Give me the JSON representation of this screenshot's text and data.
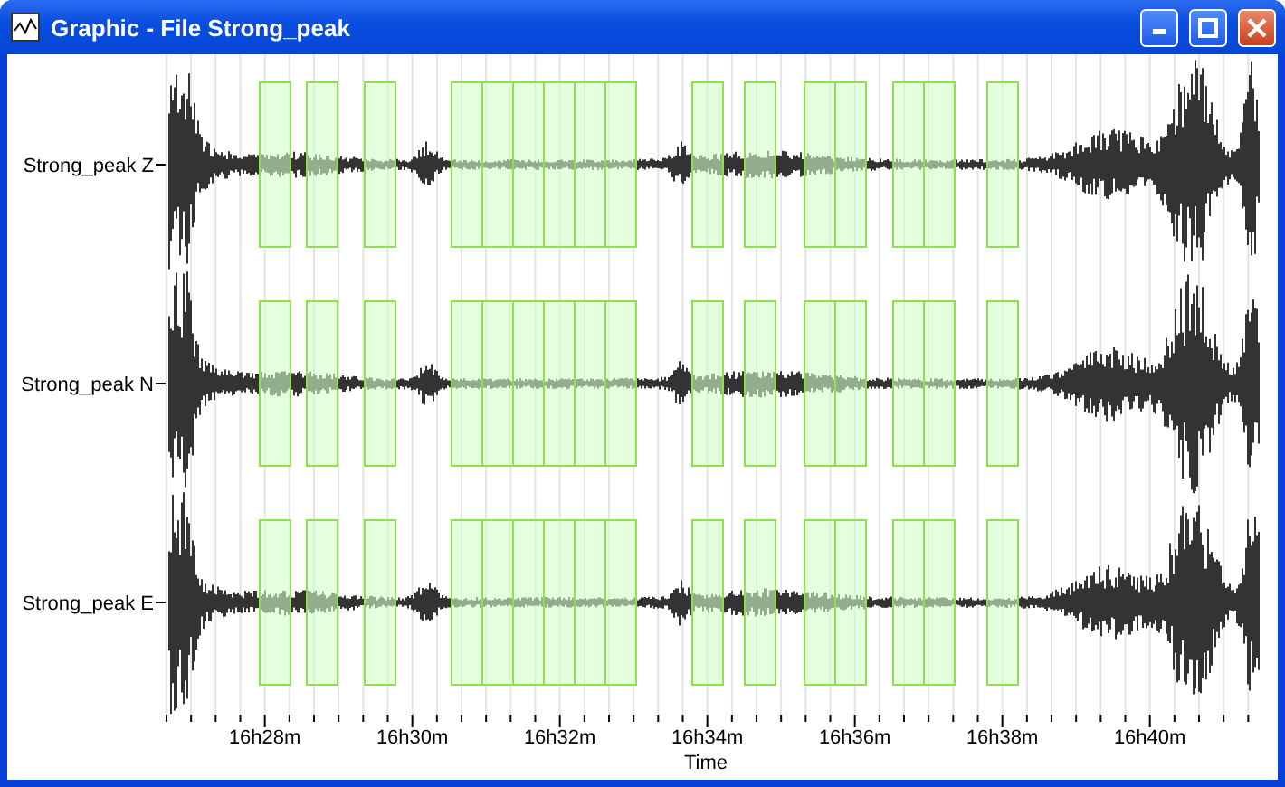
{
  "window": {
    "title": "Graphic - File Strong_peak"
  },
  "channels": [
    {
      "name": "Strong_peak Z"
    },
    {
      "name": "Strong_peak N"
    },
    {
      "name": "Strong_peak E"
    }
  ],
  "x_axis": {
    "label": "Time",
    "ticks": [
      "16h28m",
      "16h30m",
      "16h32m",
      "16h34m",
      "16h36m",
      "16h38m",
      "16h40m"
    ]
  }
}
